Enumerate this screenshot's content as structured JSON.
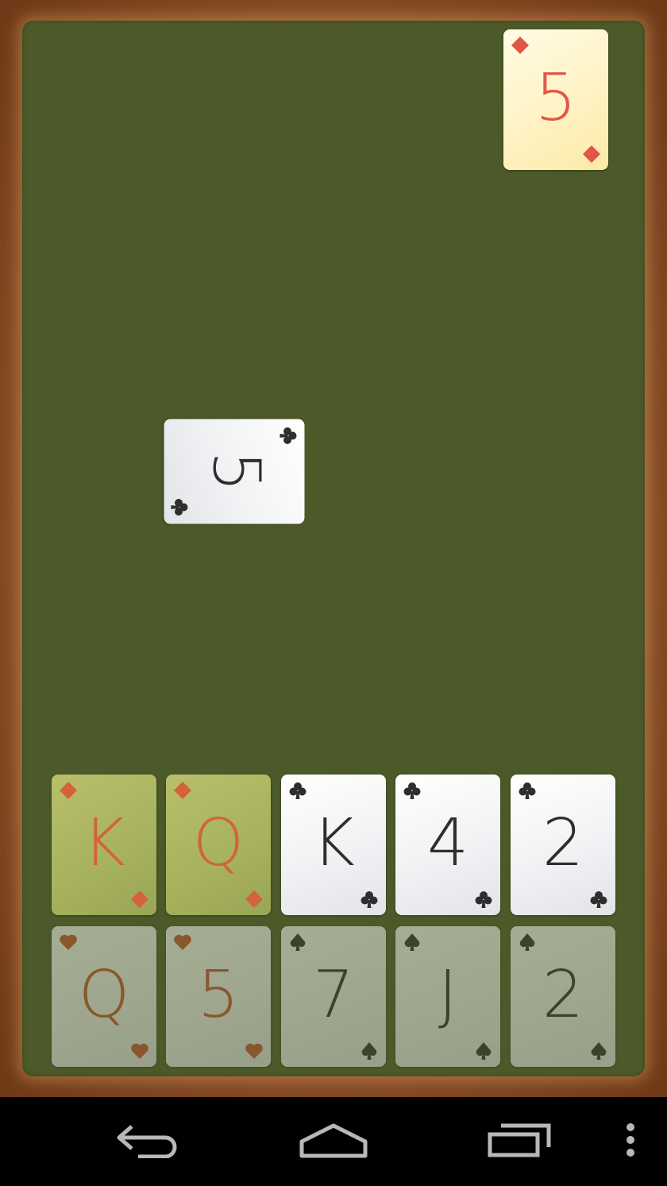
{
  "table": {
    "stock_card": {
      "rank": "5",
      "suit": "diamonds",
      "icon": "diamond-icon"
    },
    "played_card": {
      "rank": "5",
      "suit": "clubs",
      "icon": "club-icon"
    }
  },
  "hand": {
    "row1": [
      {
        "rank": "K",
        "suit": "diamonds",
        "icon": "diamond-icon",
        "state": "highlighted"
      },
      {
        "rank": "Q",
        "suit": "diamonds",
        "icon": "diamond-icon",
        "state": "highlighted"
      },
      {
        "rank": "K",
        "suit": "clubs",
        "icon": "club-icon",
        "state": "active"
      },
      {
        "rank": "4",
        "suit": "clubs",
        "icon": "club-icon",
        "state": "active"
      },
      {
        "rank": "2",
        "suit": "clubs",
        "icon": "club-icon",
        "state": "active"
      }
    ],
    "row2": [
      {
        "rank": "Q",
        "suit": "hearts",
        "icon": "heart-icon",
        "state": "dimmed"
      },
      {
        "rank": "5",
        "suit": "hearts",
        "icon": "heart-icon",
        "state": "dimmed"
      },
      {
        "rank": "7",
        "suit": "spades",
        "icon": "spade-icon",
        "state": "dimmed"
      },
      {
        "rank": "J",
        "suit": "spades",
        "icon": "spade-icon",
        "state": "dimmed"
      },
      {
        "rank": "2",
        "suit": "spades",
        "icon": "spade-icon",
        "state": "dimmed"
      }
    ]
  },
  "colors": {
    "felt": "#4c5a29",
    "frame": "#8a4f28",
    "red_suit": "#e0574a",
    "black_suit": "#2e2e2e"
  },
  "navbar": {
    "back": "back-icon",
    "home": "home-icon",
    "recents": "recent-apps-icon",
    "menu": "overflow-menu-icon"
  }
}
